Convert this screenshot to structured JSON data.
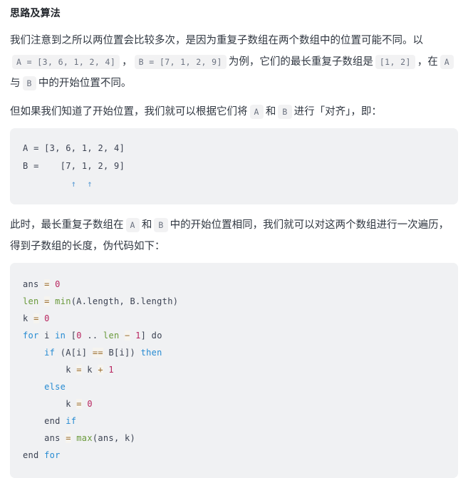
{
  "heading": "思路及算法",
  "paragraph1": {
    "segments": [
      {
        "type": "text",
        "value": "我们注意到之所以两位置会比较多次，是因为重复子数组在两个数组中的位置可能不同。以"
      },
      {
        "type": "code",
        "value": "A = [3, 6, 1, 2, 4]"
      },
      {
        "type": "text",
        "value": "，"
      },
      {
        "type": "code",
        "value": "B = [7, 1, 2, 9]"
      },
      {
        "type": "text",
        "value": "为例，它们的最长重复子数组是"
      },
      {
        "type": "code",
        "value": "[1, 2]"
      },
      {
        "type": "text",
        "value": "，在"
      },
      {
        "type": "code",
        "value": "A"
      },
      {
        "type": "text",
        "value": "与"
      },
      {
        "type": "code",
        "value": "B"
      },
      {
        "type": "text",
        "value": "中的开始位置不同。"
      }
    ]
  },
  "paragraph2": {
    "segments": [
      {
        "type": "text",
        "value": "但如果我们知道了开始位置，我们就可以根据它们将"
      },
      {
        "type": "code",
        "value": "A"
      },
      {
        "type": "text",
        "value": "和"
      },
      {
        "type": "code",
        "value": "B"
      },
      {
        "type": "text",
        "value": "进行「对齐」，即："
      }
    ]
  },
  "alignment_block": {
    "lines": [
      "A = [3, 6, 1, 2, 4]",
      "B =    [7, 1, 2, 9]",
      "         ↑  ↑"
    ],
    "raw": "A = [3, 6, 1, 2, 4]\nB =    [7, 1, 2, 9]\n         ↑  ↑"
  },
  "paragraph3": {
    "segments": [
      {
        "type": "text",
        "value": "此时，最长重复子数组在"
      },
      {
        "type": "code",
        "value": "A"
      },
      {
        "type": "text",
        "value": "和"
      },
      {
        "type": "code",
        "value": "B"
      },
      {
        "type": "text",
        "value": "中的开始位置相同，我们就可以对这两个数组进行一次遍历，得到子数组的长度，伪代码如下："
      }
    ]
  },
  "pseudocode": {
    "lines": [
      [
        {
          "t": "plain",
          "v": "ans "
        },
        {
          "t": "op",
          "v": "="
        },
        {
          "t": "plain",
          "v": " "
        },
        {
          "t": "num",
          "v": "0"
        }
      ],
      [
        {
          "t": "var",
          "v": "len"
        },
        {
          "t": "plain",
          "v": " "
        },
        {
          "t": "op",
          "v": "="
        },
        {
          "t": "plain",
          "v": " "
        },
        {
          "t": "fn",
          "v": "min"
        },
        {
          "t": "plain",
          "v": "(A.length, B.length)"
        }
      ],
      [
        {
          "t": "plain",
          "v": "k "
        },
        {
          "t": "op",
          "v": "="
        },
        {
          "t": "plain",
          "v": " "
        },
        {
          "t": "num",
          "v": "0"
        }
      ],
      [
        {
          "t": "kw",
          "v": "for"
        },
        {
          "t": "plain",
          "v": " i "
        },
        {
          "t": "kw",
          "v": "in"
        },
        {
          "t": "plain",
          "v": " ["
        },
        {
          "t": "num",
          "v": "0"
        },
        {
          "t": "plain",
          "v": " .. "
        },
        {
          "t": "var",
          "v": "len"
        },
        {
          "t": "plain",
          "v": " "
        },
        {
          "t": "op",
          "v": "−"
        },
        {
          "t": "plain",
          "v": " "
        },
        {
          "t": "num",
          "v": "1"
        },
        {
          "t": "plain",
          "v": "] do"
        }
      ],
      [
        {
          "t": "plain",
          "v": "    "
        },
        {
          "t": "kw",
          "v": "if"
        },
        {
          "t": "plain",
          "v": " (A[i] "
        },
        {
          "t": "op",
          "v": "=="
        },
        {
          "t": "plain",
          "v": " B[i]) "
        },
        {
          "t": "kw",
          "v": "then"
        }
      ],
      [
        {
          "t": "plain",
          "v": "        k "
        },
        {
          "t": "op",
          "v": "="
        },
        {
          "t": "plain",
          "v": " k "
        },
        {
          "t": "op",
          "v": "+"
        },
        {
          "t": "plain",
          "v": " "
        },
        {
          "t": "num",
          "v": "1"
        }
      ],
      [
        {
          "t": "plain",
          "v": "    "
        },
        {
          "t": "kw",
          "v": "else"
        }
      ],
      [
        {
          "t": "plain",
          "v": "        k "
        },
        {
          "t": "op",
          "v": "="
        },
        {
          "t": "plain",
          "v": " "
        },
        {
          "t": "num",
          "v": "0"
        }
      ],
      [
        {
          "t": "plain",
          "v": "    end "
        },
        {
          "t": "kw",
          "v": "if"
        }
      ],
      [
        {
          "t": "plain",
          "v": "    ans "
        },
        {
          "t": "op",
          "v": "="
        },
        {
          "t": "plain",
          "v": " "
        },
        {
          "t": "fn",
          "v": "max"
        },
        {
          "t": "plain",
          "v": "(ans, k)"
        }
      ],
      [
        {
          "t": "plain",
          "v": "end "
        },
        {
          "t": "kw",
          "v": "for"
        }
      ]
    ]
  },
  "colors": {
    "page_background": "#ffffff",
    "text": "#2f3640",
    "heading": "#1f2329",
    "code_block_background": "#f0f1f3",
    "inline_chip_background": "#f2f2f3",
    "inline_chip_text": "#6b7280",
    "keyword": "#268bd2",
    "function": "#6a9a3b",
    "number": "#b8255f",
    "operator": "#9a6c2e",
    "arrow": "#5a9bd4"
  }
}
